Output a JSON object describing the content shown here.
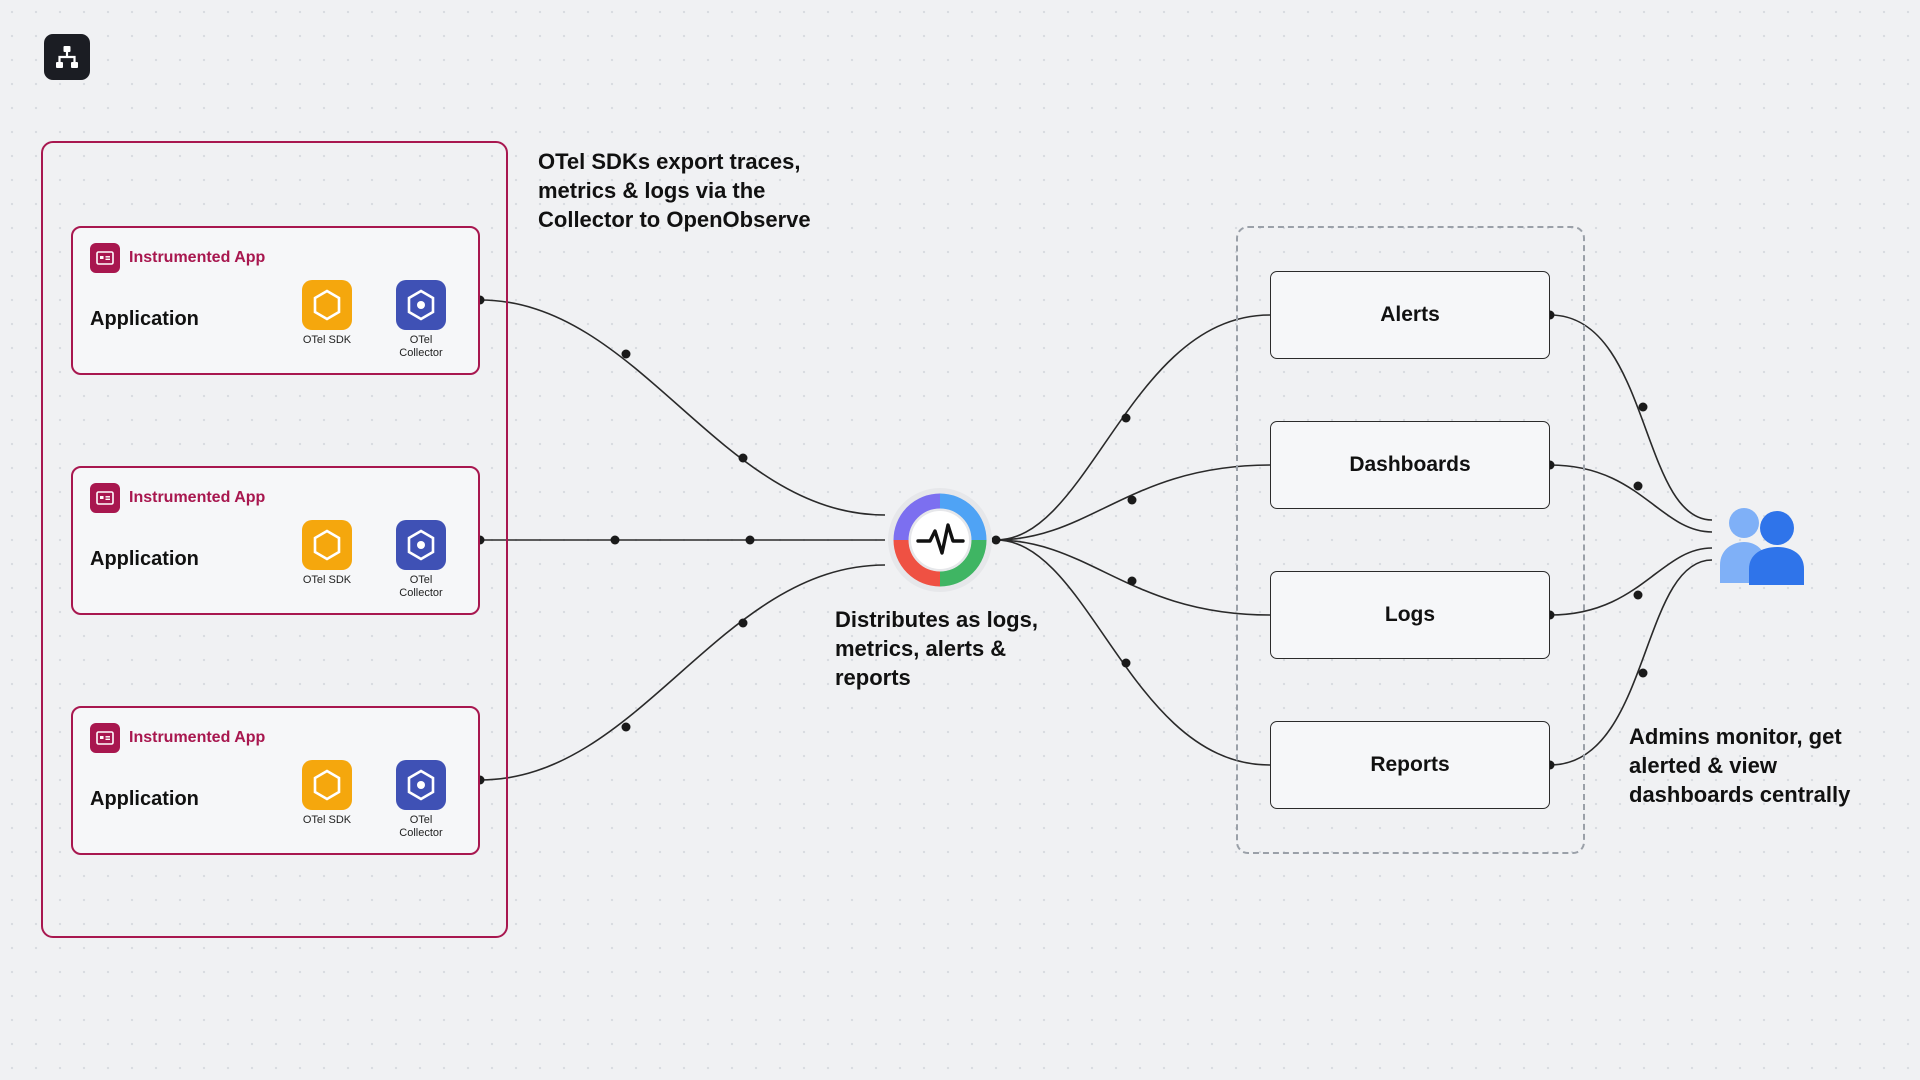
{
  "logo": {
    "icon": "sitemap-icon"
  },
  "source_group": {
    "apps": [
      {
        "badge": "Instrumented App",
        "title": "Application",
        "sdk_label": "OTel SDK",
        "collector_label": "OTel\nCollector"
      },
      {
        "badge": "Instrumented App",
        "title": "Application",
        "sdk_label": "OTel SDK",
        "collector_label": "OTel\nCollector"
      },
      {
        "badge": "Instrumented App",
        "title": "Application",
        "sdk_label": "OTel SDK",
        "collector_label": "OTel\nCollector"
      }
    ]
  },
  "captions": {
    "export": "OTel SDKs export traces,\nmetrics & logs via the\nCollector to OpenObserve",
    "distribute": "Distributes as logs,\nmetrics, alerts &\nreports",
    "admins": "Admins monitor, get\nalerted & view\ndashboards centrally"
  },
  "destinations": [
    {
      "label": "Alerts"
    },
    {
      "label": "Dashboards"
    },
    {
      "label": "Logs"
    },
    {
      "label": "Reports"
    }
  ],
  "colors": {
    "accent": "#a8174f",
    "sdk": "#f5a70d",
    "collector": "#3f51b5",
    "users": "#2f74ea",
    "users_light": "#7fb0f7"
  }
}
